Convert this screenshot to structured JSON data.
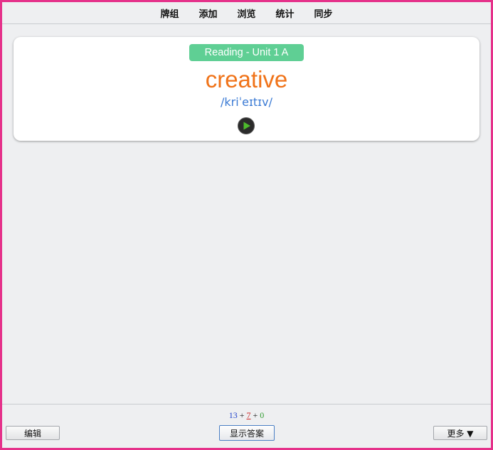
{
  "nav": {
    "items": [
      {
        "label": "牌组"
      },
      {
        "label": "添加"
      },
      {
        "label": "浏览"
      },
      {
        "label": "统计"
      },
      {
        "label": "同步"
      }
    ]
  },
  "card": {
    "deck": "Reading - Unit 1 A",
    "word": "creative",
    "phonetic": "/kriˈeɪtɪv/",
    "play_icon": "play-icon"
  },
  "counts": {
    "new": "13",
    "learning": "7",
    "review": "0",
    "sep1": "+",
    "sep2": "+"
  },
  "buttons": {
    "edit": "编辑",
    "show_answer": "显示答案",
    "more": "更多 ▼"
  },
  "colors": {
    "frame": "#e5318a",
    "deck_badge": "#5fcf94",
    "word": "#f07319",
    "phonetic": "#3a7ad4",
    "new_count": "#2244cc",
    "learning_count": "#cc2222",
    "review_count": "#2e9b2e"
  }
}
